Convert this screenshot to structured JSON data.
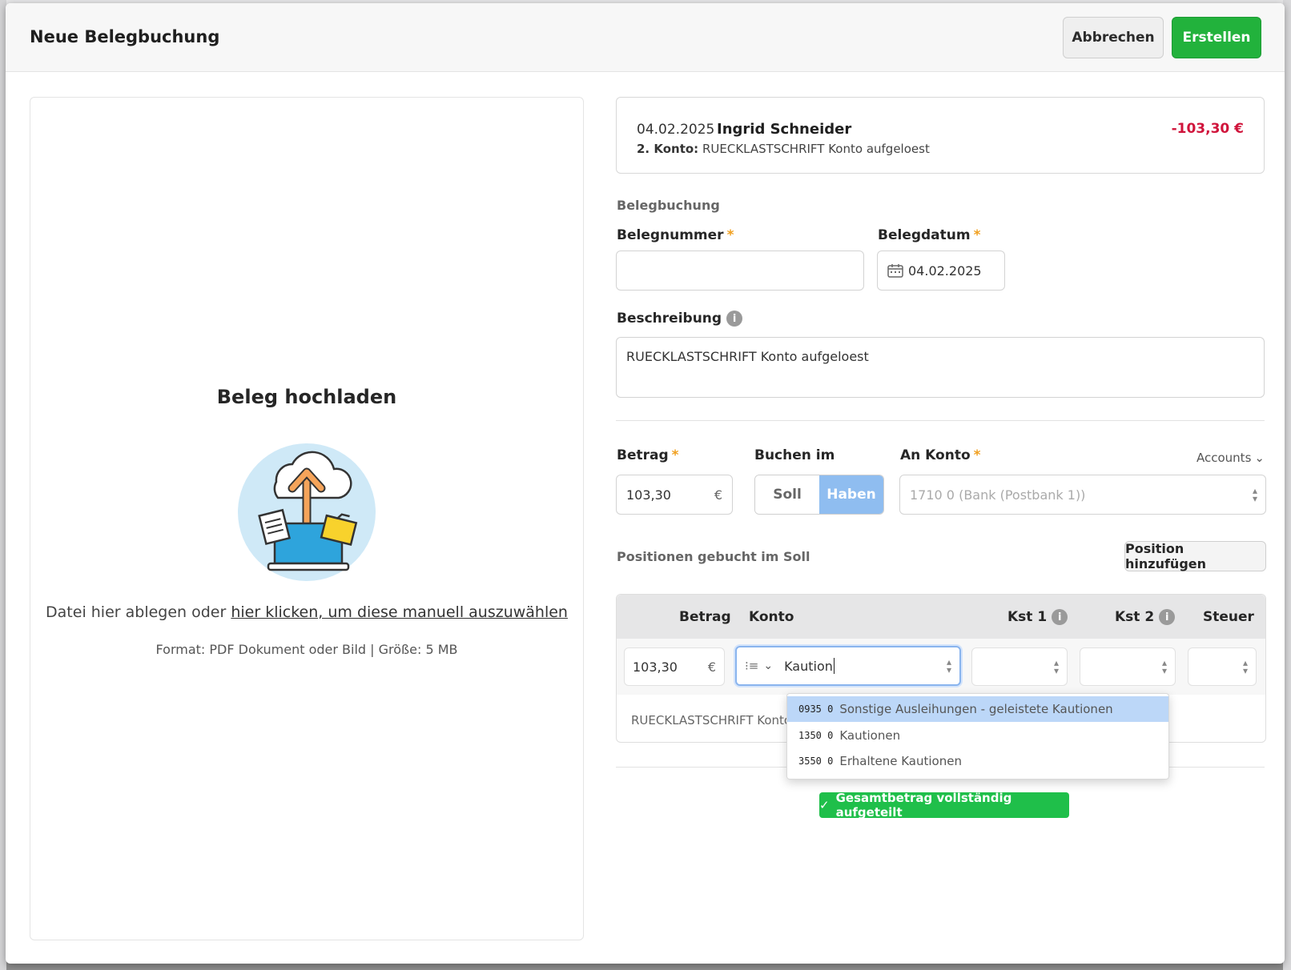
{
  "header": {
    "title": "Neue Belegbuchung",
    "cancel_label": "Abbrechen",
    "create_label": "Erstellen"
  },
  "upload": {
    "title": "Beleg hochladen",
    "hint_prefix": "Datei hier ablegen oder ",
    "hint_link": "hier klicken, um diese manuell auszuwählen",
    "format": "Format: PDF Dokument oder Bild | Größe: 5 MB"
  },
  "transaction": {
    "date": "04.02.2025",
    "name": "Ingrid Schneider",
    "amount": "-103,30 €",
    "sub_label": "2. Konto:",
    "sub_value": "RUECKLASTSCHRIFT Konto aufgeloest"
  },
  "form": {
    "section_title": "Belegbuchung",
    "belegnummer_label": "Belegnummer",
    "belegnummer_value": "",
    "belegdatum_label": "Belegdatum",
    "belegdatum_value": "04.02.2025",
    "beschreibung_label": "Beschreibung",
    "beschreibung_value": "RUECKLASTSCHRIFT Konto aufgeloest",
    "betrag_label": "Betrag",
    "betrag_value": "103,30",
    "currency": "€",
    "buchen_label": "Buchen im",
    "soll_label": "Soll",
    "haben_label": "Haben",
    "an_konto_label": "An Konto",
    "accounts_label": "Accounts",
    "an_konto_placeholder": "1710 0 (Bank (Postbank 1))",
    "required_mark": "*"
  },
  "positions": {
    "title": "Positionen gebucht im Soll",
    "add_label": "Position hinzufügen",
    "columns": {
      "betrag": "Betrag",
      "konto": "Konto",
      "kst1": "Kst 1",
      "kst2": "Kst 2",
      "steuer": "Steuer"
    },
    "row": {
      "betrag": "103,30",
      "konto_query": "Kaution",
      "description": "RUECKLASTSCHRIFT Konto"
    },
    "dropdown": [
      {
        "code": "0935 0",
        "label": "Sonstige Ausleihungen - geleistete Kautionen"
      },
      {
        "code": "1350 0",
        "label": "Kautionen"
      },
      {
        "code": "3550 0",
        "label": "Erhaltene Kautionen"
      }
    ]
  },
  "status": {
    "success_label": "Gesamtbetrag vollständig aufgeteilt"
  },
  "colors": {
    "accent_green": "#22b23c",
    "negative_amount": "#d0143b",
    "selected_segment": "#8fbdf0",
    "dropdown_active": "#bcd7f8"
  }
}
